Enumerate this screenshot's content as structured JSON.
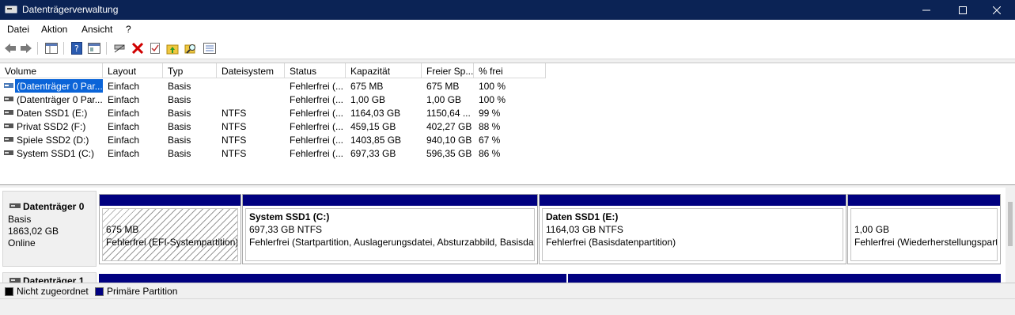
{
  "window": {
    "title": "Datenträgerverwaltung"
  },
  "menu": {
    "datei": "Datei",
    "aktion": "Aktion",
    "ansicht": "Ansicht",
    "help": "?"
  },
  "columns": [
    "Volume",
    "Layout",
    "Typ",
    "Dateisystem",
    "Status",
    "Kapazität",
    "Freier Sp...",
    "% frei"
  ],
  "volumes": [
    {
      "volume": "(Datenträger 0 Par...",
      "layout": "Einfach",
      "typ": "Basis",
      "fs": "",
      "status": "Fehlerfrei (...",
      "cap": "675 MB",
      "free": "675 MB",
      "pct": "100 %"
    },
    {
      "volume": "(Datenträger 0 Par...",
      "layout": "Einfach",
      "typ": "Basis",
      "fs": "",
      "status": "Fehlerfrei (...",
      "cap": "1,00 GB",
      "free": "1,00 GB",
      "pct": "100 %"
    },
    {
      "volume": "Daten SSD1 (E:)",
      "layout": "Einfach",
      "typ": "Basis",
      "fs": "NTFS",
      "status": "Fehlerfrei (...",
      "cap": "1164,03 GB",
      "free": "1150,64 ...",
      "pct": "99 %"
    },
    {
      "volume": "Privat SSD2 (F:)",
      "layout": "Einfach",
      "typ": "Basis",
      "fs": "NTFS",
      "status": "Fehlerfrei (...",
      "cap": "459,15 GB",
      "free": "402,27 GB",
      "pct": "88 %"
    },
    {
      "volume": "Spiele SSD2 (D:)",
      "layout": "Einfach",
      "typ": "Basis",
      "fs": "NTFS",
      "status": "Fehlerfrei (...",
      "cap": "1403,85 GB",
      "free": "940,10 GB",
      "pct": "67 %"
    },
    {
      "volume": "System SSD1 (C:)",
      "layout": "Einfach",
      "typ": "Basis",
      "fs": "NTFS",
      "status": "Fehlerfrei (...",
      "cap": "697,33 GB",
      "free": "596,35 GB",
      "pct": "86 %"
    }
  ],
  "disk0": {
    "name": "Datenträger 0",
    "type": "Basis",
    "size": "1863,02 GB",
    "state": "Online",
    "partitions": [
      {
        "title": "",
        "size": "675 MB",
        "status": "Fehlerfrei (EFI-Systempartition)"
      },
      {
        "title": "System SSD1  (C:)",
        "size": "697,33 GB NTFS",
        "status": "Fehlerfrei (Startpartition, Auslagerungsdatei, Absturzabbild, Basisdatenpartition)"
      },
      {
        "title": "Daten SSD1  (E:)",
        "size": "1164,03 GB NTFS",
        "status": "Fehlerfrei (Basisdatenpartition)"
      },
      {
        "title": "",
        "size": "1,00 GB",
        "status": "Fehlerfrei (Wiederherstellungspartition)"
      }
    ]
  },
  "disk1": {
    "name": "Datenträger 1"
  },
  "legend": {
    "unallocated": "Nicht zugeordnet",
    "primary": "Primäre Partition"
  },
  "colors": {
    "primary": "#000080",
    "unallocated": "#000000",
    "titlebar": "#0b2355"
  }
}
